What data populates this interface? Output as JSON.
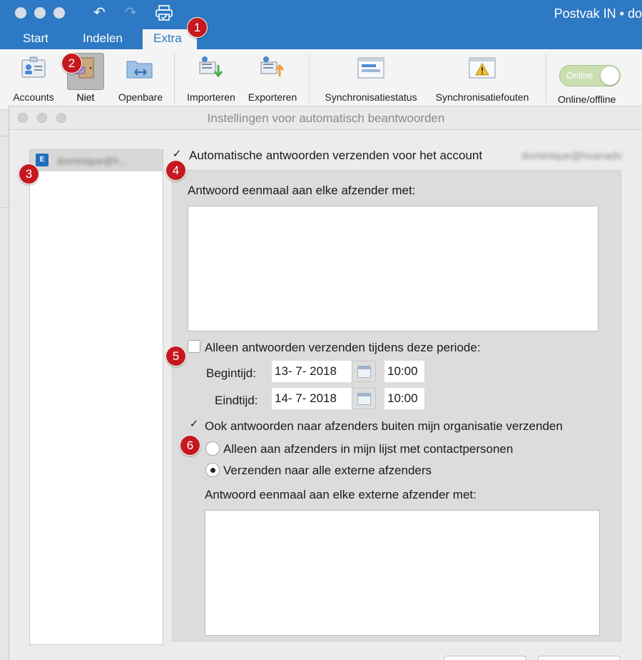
{
  "window": {
    "title": "Postvak IN • do"
  },
  "toolbar_icons": [
    "undo-icon",
    "redo-icon",
    "print-icon"
  ],
  "tabs": [
    {
      "label": "Start"
    },
    {
      "label": "Indelen"
    },
    {
      "label": "Extra",
      "active": true
    }
  ],
  "ribbon": {
    "accounts": "Accounts",
    "niet": "Niet",
    "openbare": "Openbare",
    "importeren": "Importeren",
    "exporteren": "Exporteren",
    "sync_status": "Synchronisatiestatus",
    "sync_errors": "Synchronisatiefouten",
    "online_toggle": "Online",
    "online_offline": "Online/offline"
  },
  "dialog": {
    "title": "Instellingen voor automatisch beantwoorden",
    "account_name": "dominique@h...",
    "auto_reply": {
      "checked": true,
      "label": "Automatische antwoorden verzenden voor het account",
      "account_blurred": "dominique@hvanadv"
    },
    "reply_label": "Antwoord eenmaal aan elke afzender met:",
    "reply_text": "",
    "period": {
      "checked": false,
      "label": "Alleen antwoorden verzenden tijdens deze periode:",
      "start_label": "Begintijd:",
      "start_date": "13-  7- 2018",
      "start_time": "10:00",
      "end_label": "Eindtijd:",
      "end_date": "14-  7- 2018",
      "end_time": "10:00"
    },
    "external": {
      "checked": true,
      "label": "Ook antwoorden naar afzenders buiten mijn organisatie verzenden",
      "option_contacts": "Alleen aan afzenders in mijn lijst met contactpersonen",
      "option_all": "Verzenden naar alle externe afzenders",
      "selected": "option_all",
      "reply_label": "Antwoord eenmaal aan elke externe afzender met:",
      "reply_text": ""
    }
  },
  "badges": [
    "1",
    "2",
    "3",
    "4",
    "5",
    "6"
  ],
  "colors": {
    "accent": "#2e79c3",
    "badge": "#c5181f"
  }
}
